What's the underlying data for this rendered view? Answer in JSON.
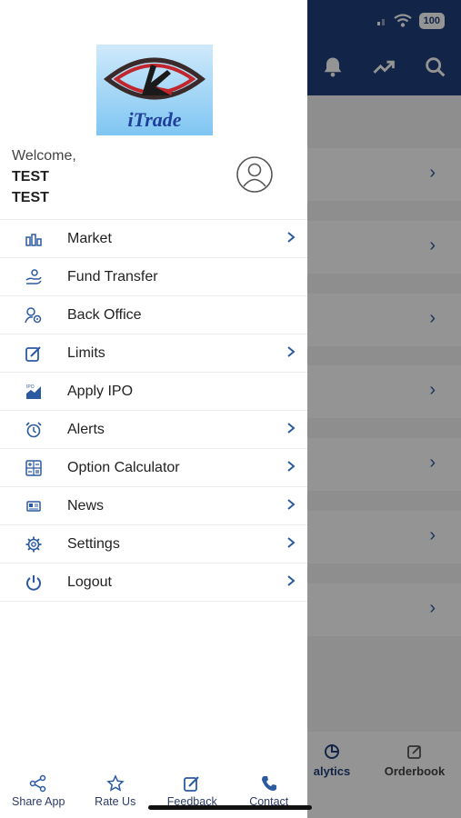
{
  "status_bar": {
    "battery": "100"
  },
  "background": {
    "tabs": [
      {
        "label": "alytics",
        "icon": "pie-chart-icon"
      },
      {
        "label": "Orderbook",
        "icon": "edit-icon"
      }
    ],
    "header_icons": [
      "bell-icon",
      "trend-up-icon",
      "search-icon"
    ]
  },
  "drawer": {
    "logo_text": "iTrade",
    "welcome": {
      "greeting": "Welcome,",
      "line1": "TEST",
      "line2": "TEST"
    },
    "menu": [
      {
        "label": "Market",
        "icon": "bar-chart-icon",
        "has_chevron": true
      },
      {
        "label": "Fund Transfer",
        "icon": "fund-transfer-icon",
        "has_chevron": false
      },
      {
        "label": "Back Office",
        "icon": "user-settings-icon",
        "has_chevron": false
      },
      {
        "label": "Limits",
        "icon": "edit-icon",
        "has_chevron": true
      },
      {
        "label": "Apply IPO",
        "icon": "ipo-icon",
        "has_chevron": false
      },
      {
        "label": "Alerts",
        "icon": "alarm-clock-icon",
        "has_chevron": true
      },
      {
        "label": "Option Calculator",
        "icon": "calculator-icon",
        "has_chevron": true
      },
      {
        "label": "News",
        "icon": "newspaper-icon",
        "has_chevron": true
      },
      {
        "label": "Settings",
        "icon": "gear-icon",
        "has_chevron": true
      },
      {
        "label": "Logout",
        "icon": "power-icon",
        "has_chevron": true
      }
    ],
    "footer": [
      {
        "label": "Share App",
        "icon": "share-icon"
      },
      {
        "label": "Rate Us",
        "icon": "star-icon"
      },
      {
        "label": "Feedback",
        "icon": "feedback-icon"
      },
      {
        "label": "Contact",
        "icon": "phone-icon"
      }
    ]
  },
  "colors": {
    "header_blue": "#1f3f7a",
    "icon_blue": "#2c5aa0",
    "footer_text": "#2b3b66"
  }
}
